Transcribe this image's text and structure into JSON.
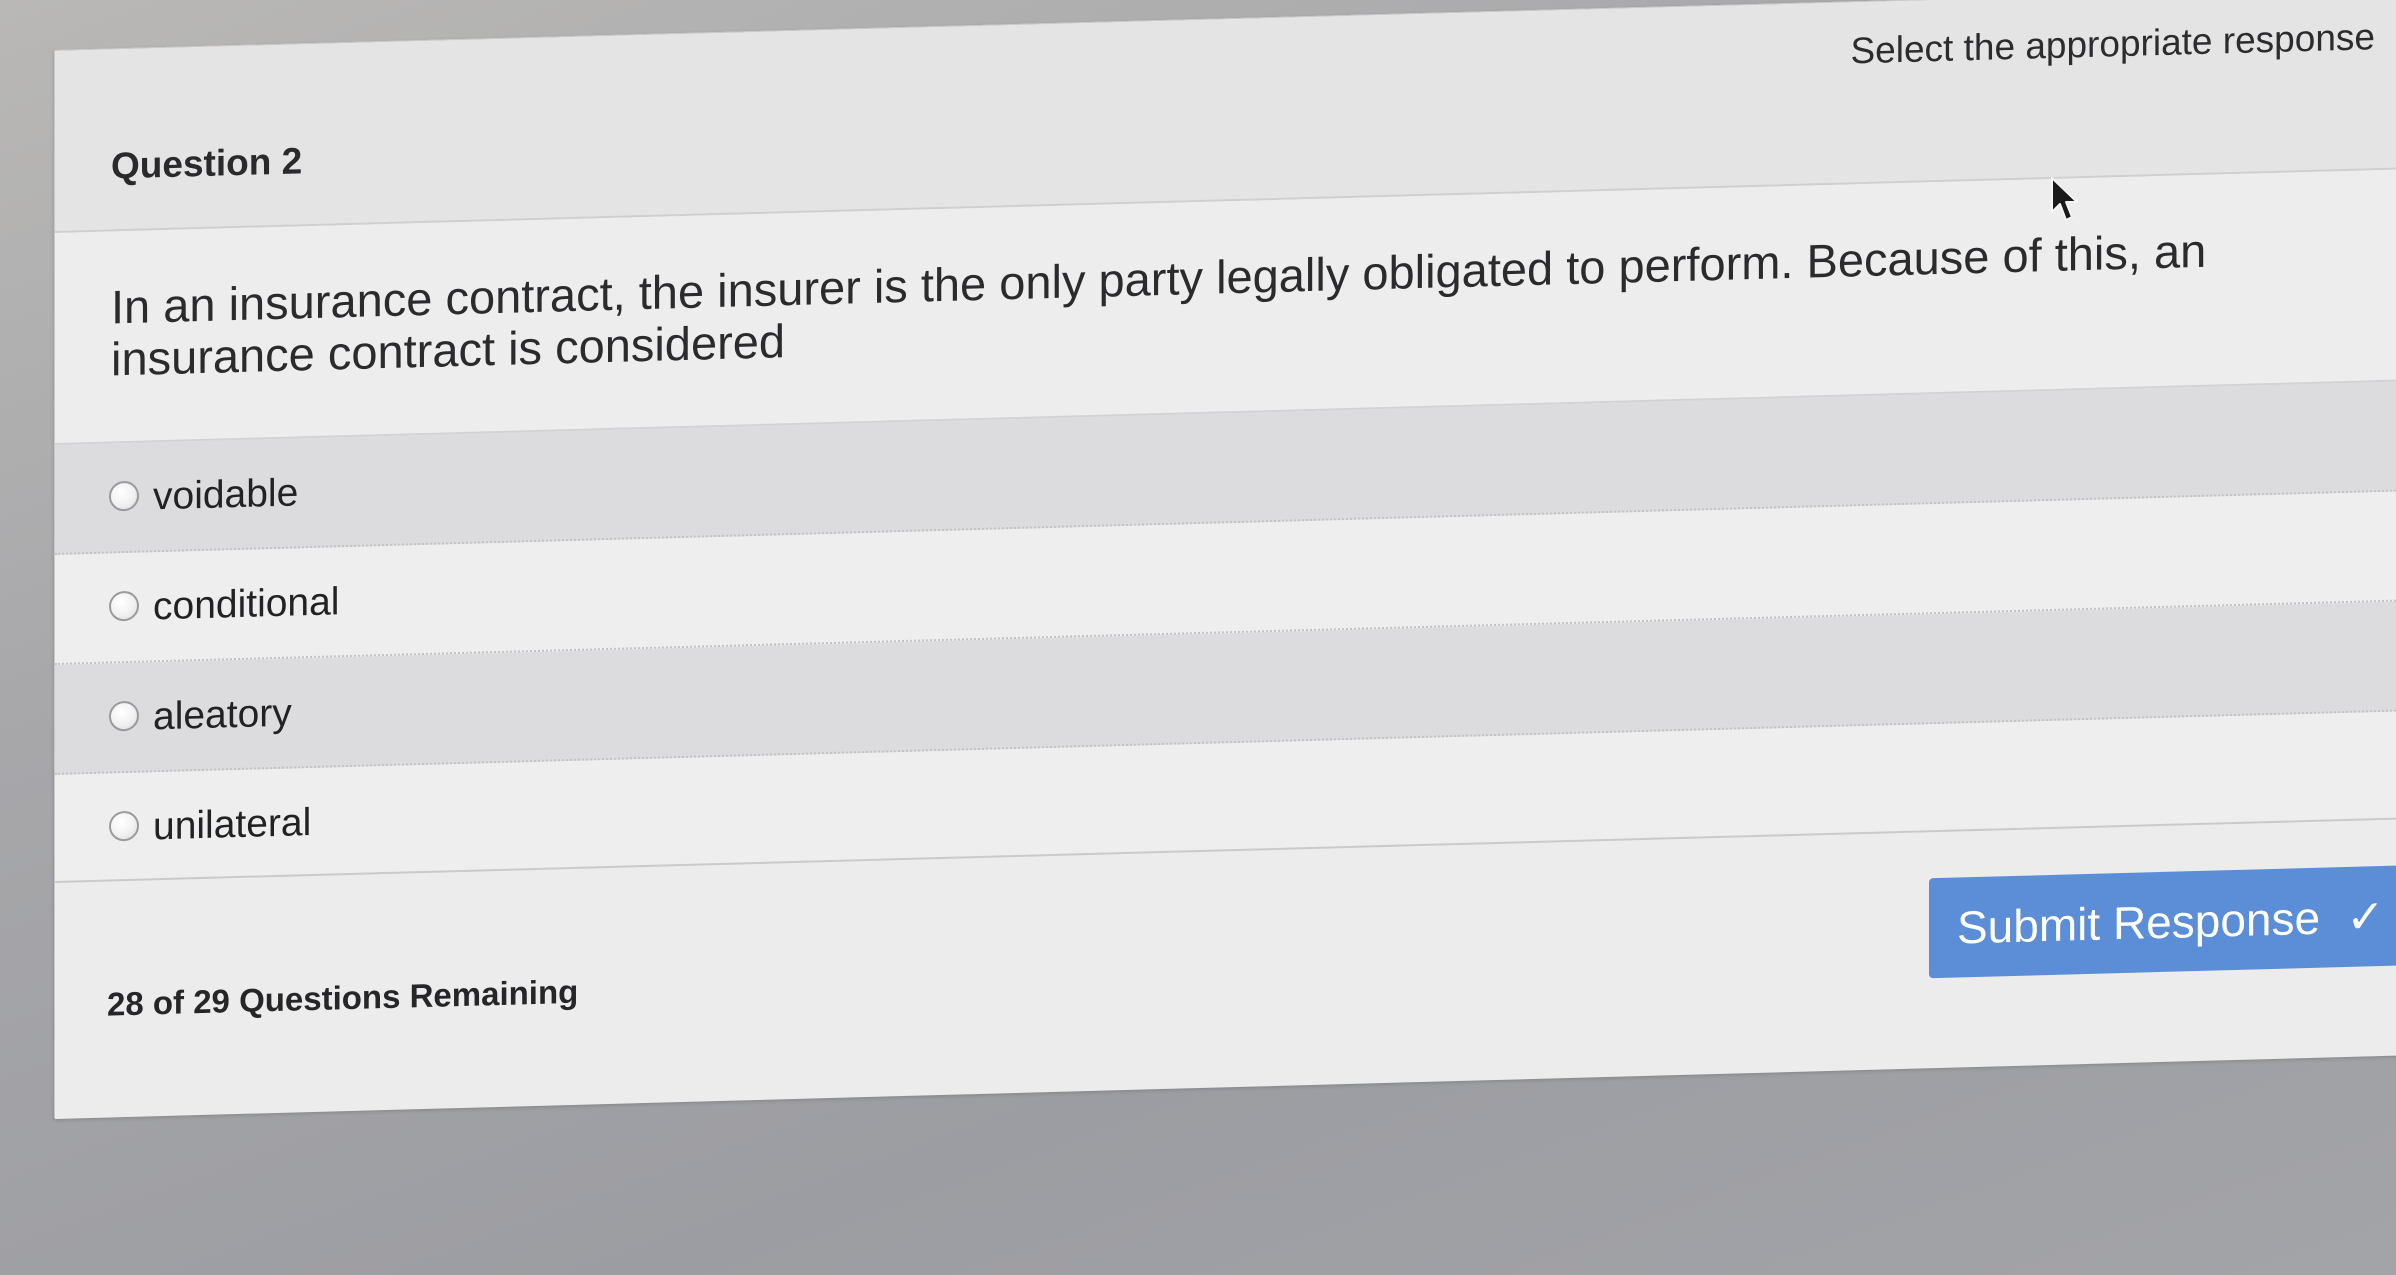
{
  "header": {
    "question_number": "Question 2",
    "instruction": "Select the appropriate response"
  },
  "question": {
    "text": "In an insurance contract, the insurer is the only party legally obligated to perform. Because of this, an insurance contract is considered"
  },
  "options": [
    {
      "label": "voidable",
      "selected": false
    },
    {
      "label": "conditional",
      "selected": false
    },
    {
      "label": "aleatory",
      "selected": false
    },
    {
      "label": "unilateral",
      "selected": false
    }
  ],
  "footer": {
    "remaining": "28 of 29 Questions Remaining",
    "submit_label": "Submit Response",
    "submit_icon": "checkmark-icon"
  },
  "colors": {
    "submit_button": "#5b8ed6",
    "panel": "#ebebec"
  }
}
